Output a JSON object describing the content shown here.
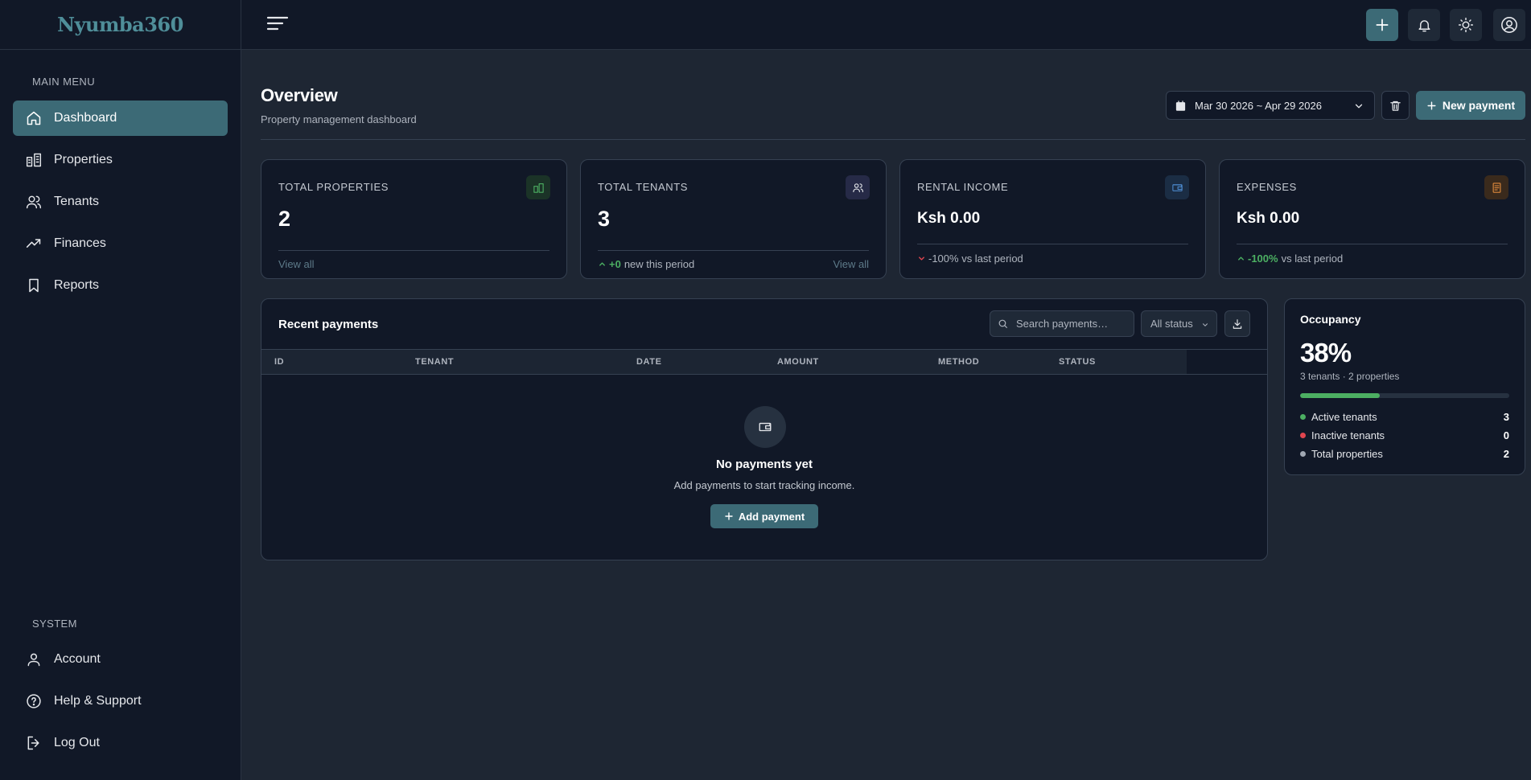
{
  "app": {
    "logo": "Nyumba360"
  },
  "sidebar": {
    "main_heading": "MAIN MENU",
    "items": [
      {
        "label": "Dashboard",
        "icon": "home-icon",
        "active": true
      },
      {
        "label": "Properties",
        "icon": "buildings-icon"
      },
      {
        "label": "Tenants",
        "icon": "users-icon"
      },
      {
        "label": "Finances",
        "icon": "trending-up-icon"
      },
      {
        "label": "Reports",
        "icon": "bookmark-icon"
      }
    ],
    "system_heading": "SYSTEM",
    "system_items": [
      {
        "label": "Account",
        "icon": "user-icon"
      },
      {
        "label": "Help & Support",
        "icon": "help-circle-icon"
      },
      {
        "label": "Log Out",
        "icon": "logout-icon"
      }
    ]
  },
  "topbar": {
    "buttons": [
      "plus-icon",
      "bell-icon",
      "sun-icon",
      "user-circle-icon"
    ]
  },
  "header": {
    "title": "Overview",
    "subtitle": "Property management dashboard",
    "date_range": "Mar 30 2026 ~ Apr 29 2026",
    "new_payment_label": "New payment"
  },
  "stats": {
    "properties": {
      "label": "TOTAL PROPERTIES",
      "value": "2",
      "link": "View all"
    },
    "tenants": {
      "label": "TOTAL TENANTS",
      "value": "3",
      "delta": "+0",
      "delta_text": "new this period",
      "link": "View all"
    },
    "income": {
      "label": "RENTAL INCOME",
      "value": "Ksh 0.00",
      "delta_text": "-100% vs last period"
    },
    "expenses": {
      "label": "EXPENSES",
      "value": "Ksh 0.00",
      "delta": "-100%",
      "delta_text": "vs last period"
    }
  },
  "payments": {
    "title": "Recent payments",
    "search_placeholder": "Search payments…",
    "status_filter": "All status",
    "columns": [
      "ID",
      "TENANT",
      "DATE",
      "AMOUNT",
      "METHOD",
      "STATUS"
    ],
    "rows": [],
    "empty_title": "No payments yet",
    "empty_text": "Add payments to start tracking income.",
    "add_label": "Add payment"
  },
  "occupancy": {
    "title": "Occupancy",
    "value": "38%",
    "fraction": 0.38,
    "subtitle": "3 tenants · 2 properties",
    "rows": [
      {
        "label": "Active tenants",
        "value": "3",
        "color": "#4caf62"
      },
      {
        "label": "Inactive tenants",
        "value": "0",
        "color": "#e0454f"
      },
      {
        "label": "Total properties",
        "value": "2",
        "color": "#a0a7b2"
      }
    ]
  },
  "colors": {
    "accent": "#3c6a76",
    "positive": "#4caf62",
    "negative": "#e0454f",
    "background": "#1e2633",
    "panel": "#111827"
  }
}
